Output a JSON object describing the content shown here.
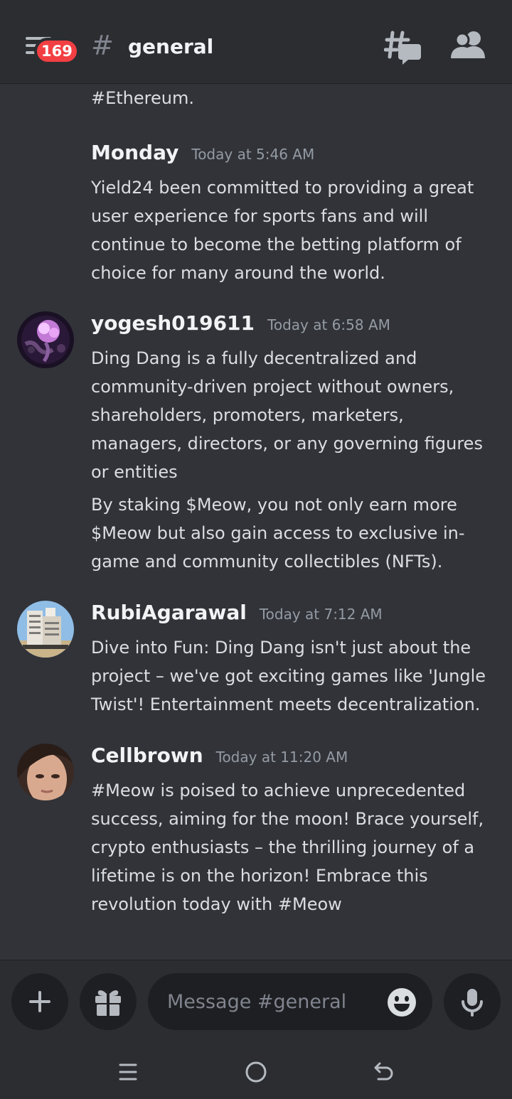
{
  "header": {
    "unread_badge": "169",
    "channel_name": "general",
    "icons": [
      "menu-icon",
      "hashtag-icon",
      "threads-icon",
      "members-icon"
    ]
  },
  "messages": [
    {
      "continuation": true,
      "paragraphs": [
        "#Ethereum."
      ]
    },
    {
      "username": "Monday",
      "timestamp": "Today at 5:46 AM",
      "paragraphs": [
        "Yield24 been committed to providing a great user experience for sports fans and will continue to become the betting platform of choice for many around the world."
      ]
    },
    {
      "username": "yogesh019611",
      "timestamp": "Today at 6:58 AM",
      "paragraphs": [
        "Ding Dang is a fully decentralized and community-driven project without owners, shareholders, promoters, marketers, managers, directors, or any governing figures or entities",
        "By staking $Meow, you not only earn more $Meow but also gain access to exclusive in-game and community collectibles (NFTs)."
      ]
    },
    {
      "username": "RubiAgarawal",
      "timestamp": "Today at 7:12 AM",
      "paragraphs": [
        "Dive into Fun: Ding Dang isn't just about the project – we've got exciting games like 'Jungle Twist'! Entertainment meets decentralization."
      ]
    },
    {
      "username": "Cellbrown",
      "timestamp": "Today at 11:20 AM",
      "paragraphs": [
        "#Meow is poised to achieve unprecedented success, aiming for the moon! Brace yourself, crypto enthusiasts – the thrilling journey of a lifetime is on the horizon! Embrace this revolution today with #Meow"
      ]
    }
  ],
  "composer": {
    "placeholder": "Message #general",
    "icons": [
      "plus-icon",
      "gift-icon",
      "emoji-icon",
      "microphone-icon"
    ]
  },
  "system_nav": {
    "icons": [
      "recent-apps-icon",
      "home-icon",
      "back-icon"
    ]
  },
  "colors": {
    "background": "#313338",
    "header": "#2b2d31",
    "input": "#1e1f22",
    "badge": "#f23f43",
    "text": "#dbdee1",
    "muted": "#949ba4"
  }
}
